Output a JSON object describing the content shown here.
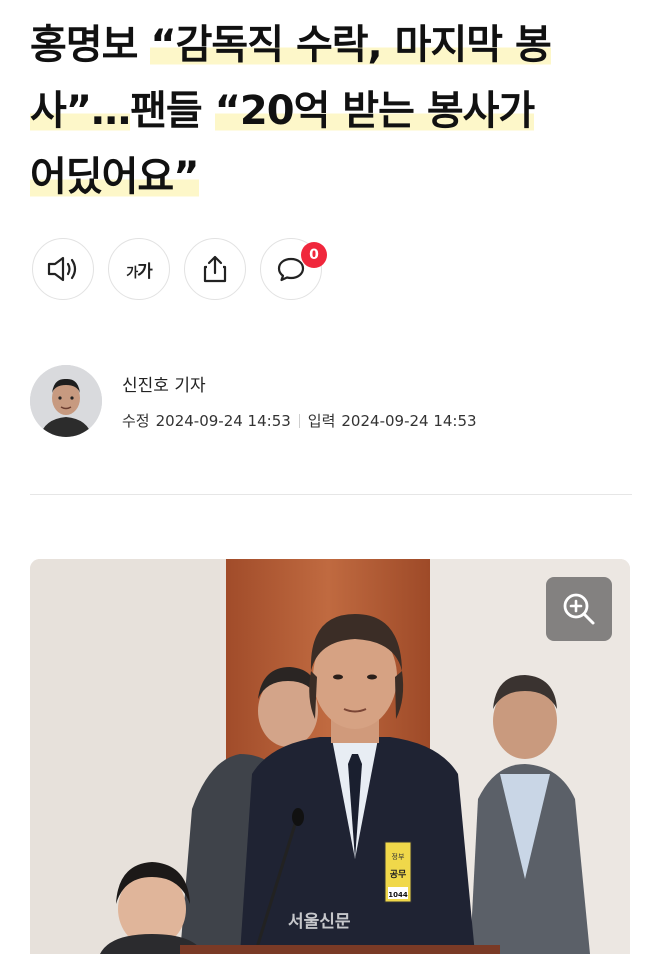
{
  "article": {
    "headline": {
      "line1_plain": "홍명보 ",
      "line1_hl": "“감독직 수락, 마지막 봉",
      "line2_hl1": "사”…",
      "line2_plain": "팬들 ",
      "line2_hl2": "“20억 받는 봉사가",
      "line3_hl": "어딨어요”"
    },
    "actions": {
      "font_label_small": "가",
      "font_label_large": "가",
      "comment_count": "0"
    },
    "author": {
      "name": "신진호 기자",
      "modified_label": "수정",
      "modified_date": "2024-09-24 14:53",
      "published_label": "입력",
      "published_date": "2024-09-24 14:53"
    },
    "photo": {
      "badge_label": "공무",
      "badge_number": "1044",
      "watermark": "서울신문"
    }
  },
  "colors": {
    "highlight": "#fdf7c9",
    "badge": "#f0273c"
  },
  "icons": {
    "listen": "speaker-icon",
    "font": "font-size-icon",
    "share": "share-icon",
    "comment": "comment-icon",
    "zoom": "zoom-in-icon"
  }
}
